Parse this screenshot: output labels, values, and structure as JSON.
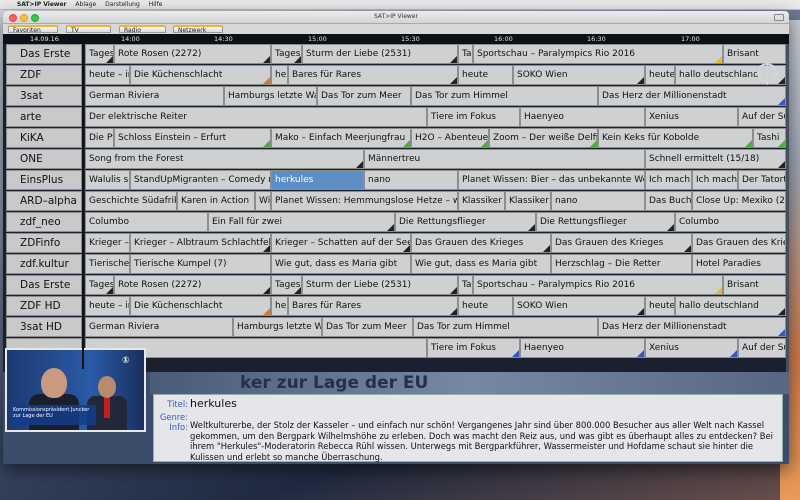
{
  "menubar": {
    "apple": "",
    "app_name": "SAT>IP Viewer",
    "items": [
      "Ablage",
      "Darstellung",
      "Hilfe"
    ]
  },
  "window": {
    "title": "SAT>IP Viewer"
  },
  "tabs": [
    "Favoriten",
    "TV",
    "Radio",
    "Netzwerk"
  ],
  "time_header": {
    "date": "14.09.16",
    "times": [
      "14:00",
      "14:30",
      "15:00",
      "15:30",
      "16:00",
      "16:30",
      "17:00"
    ]
  },
  "channels": [
    {
      "name": "Das Erste",
      "programs": [
        {
          "title": "Tages",
          "mark": "blk"
        },
        {
          "title": "Rote Rosen (2272)",
          "mark": "blk"
        },
        {
          "title": "Tages",
          "mark": "blk"
        },
        {
          "title": "Sturm der Liebe (2531)",
          "mark": "blk"
        },
        {
          "title": "Ta",
          "mark": ""
        },
        {
          "title": "Sportschau – Paralympics Rio 2016",
          "mark": "yel"
        },
        {
          "title": "Brisant",
          "mark": ""
        }
      ]
    },
    {
      "name": "ZDF",
      "programs": [
        {
          "title": "heute – in",
          "mark": ""
        },
        {
          "title": "Die Küchenschlacht",
          "mark": "org"
        },
        {
          "title": "he",
          "mark": ""
        },
        {
          "title": "Bares für Rares",
          "mark": "blk"
        },
        {
          "title": "heute",
          "mark": ""
        },
        {
          "title": "SOKO Wien",
          "mark": "blk"
        },
        {
          "title": "heute",
          "mark": ""
        },
        {
          "title": "hallo deutschland",
          "mark": "blk"
        }
      ]
    },
    {
      "name": "3sat",
      "programs": [
        {
          "title": "German Riviera",
          "mark": ""
        },
        {
          "title": "Hamburgs letzte Wan",
          "mark": ""
        },
        {
          "title": "Das Tor zum Meer",
          "mark": ""
        },
        {
          "title": "Das Tor zum Himmel",
          "mark": ""
        },
        {
          "title": "Das Herz der Millionenstadt",
          "mark": "blu"
        }
      ]
    },
    {
      "name": "arte",
      "programs": [
        {
          "title": "Der elektrische Reiter",
          "mark": ""
        },
        {
          "title": "Tiere im Fokus",
          "mark": ""
        },
        {
          "title": "Haenyeo",
          "mark": ""
        },
        {
          "title": "Xenius",
          "mark": ""
        },
        {
          "title": "Auf der Su",
          "mark": ""
        }
      ]
    },
    {
      "name": "KiKA",
      "programs": [
        {
          "title": "Die Pf",
          "mark": ""
        },
        {
          "title": "Schloss Einstein – Erfurt",
          "mark": "grn"
        },
        {
          "title": "Mako – Einfach Meerjungfrau",
          "mark": "grn"
        },
        {
          "title": "H2O – Abenteuer",
          "mark": "grn"
        },
        {
          "title": "Zoom – Der weiße Delfin",
          "mark": "grn"
        },
        {
          "title": "Kein Keks für Kobolde",
          "mark": "grn"
        },
        {
          "title": "Tashi",
          "mark": "grn"
        }
      ]
    },
    {
      "name": "ONE",
      "programs": [
        {
          "title": "Song from the Forest",
          "mark": "blk"
        },
        {
          "title": "Männertreu",
          "mark": ""
        },
        {
          "title": "Schnell ermittelt (15/18)",
          "mark": "blk"
        }
      ]
    },
    {
      "name": "EinsPlus",
      "programs": [
        {
          "title": "Walulis si",
          "mark": ""
        },
        {
          "title": "StandUpMigranten – Comedy mit",
          "mark": ""
        },
        {
          "title": "herkules",
          "mark": ""
        },
        {
          "title": "nano",
          "mark": ""
        },
        {
          "title": "Planet Wissen: Bier – das unbekannte Wesen",
          "mark": ""
        },
        {
          "title": "Ich mach`",
          "mark": ""
        },
        {
          "title": "Ich mach`",
          "mark": ""
        },
        {
          "title": "Der Tatort",
          "mark": ""
        }
      ]
    },
    {
      "name": "ARD–alpha",
      "programs": [
        {
          "title": "Geschichte Südafrika",
          "mark": ""
        },
        {
          "title": "Karen in Action",
          "mark": ""
        },
        {
          "title": "Wi",
          "mark": ""
        },
        {
          "title": "Planet Wissen: Hemmungslose Hetze – was",
          "mark": ""
        },
        {
          "title": "Klassiker",
          "mark": ""
        },
        {
          "title": "Klassiker",
          "mark": ""
        },
        {
          "title": "nano",
          "mark": ""
        },
        {
          "title": "Das Buch",
          "mark": ""
        },
        {
          "title": "Close Up: Mexiko (2/",
          "mark": ""
        }
      ]
    },
    {
      "name": "zdf_neo",
      "programs": [
        {
          "title": "Columbo",
          "mark": ""
        },
        {
          "title": "Ein Fall für zwei",
          "mark": "blk"
        },
        {
          "title": "Die Rettungsflieger",
          "mark": "blk"
        },
        {
          "title": "Die Rettungsflieger",
          "mark": "blk"
        },
        {
          "title": "Columbo",
          "mark": ""
        }
      ]
    },
    {
      "name": "ZDFinfo",
      "programs": [
        {
          "title": "Krieger –",
          "mark": ""
        },
        {
          "title": "Krieger – Albtraum Schlachtfeld",
          "mark": "blk"
        },
        {
          "title": "Krieger – Schatten auf der Seele",
          "mark": "blk"
        },
        {
          "title": "Das Grauen des Krieges",
          "mark": "blk"
        },
        {
          "title": "Das Grauen des Krieges",
          "mark": "blk"
        },
        {
          "title": "Das Grauen des Krieg",
          "mark": ""
        }
      ]
    },
    {
      "name": "zdf.kultur",
      "programs": [
        {
          "title": "Tierische",
          "mark": ""
        },
        {
          "title": "Tierische Kumpel (7)",
          "mark": ""
        },
        {
          "title": "Wie gut, dass es Maria gibt",
          "mark": ""
        },
        {
          "title": "Wie gut, dass es Maria gibt",
          "mark": ""
        },
        {
          "title": "Herzschlag – Die Retter",
          "mark": ""
        },
        {
          "title": "Hotel Paradies",
          "mark": ""
        }
      ]
    },
    {
      "name": "Das Erste HD",
      "programs": [
        {
          "title": "Tages",
          "mark": "blk"
        },
        {
          "title": "Rote Rosen (2272)",
          "mark": "blk"
        },
        {
          "title": "Tages",
          "mark": "blk"
        },
        {
          "title": "Sturm der Liebe (2531)",
          "mark": "blk"
        },
        {
          "title": "Ta",
          "mark": ""
        },
        {
          "title": "Sportschau – Paralympics Rio 2016",
          "mark": "yel"
        },
        {
          "title": "Brisant",
          "mark": ""
        }
      ]
    },
    {
      "name": "ZDF HD",
      "programs": [
        {
          "title": "heute – in",
          "mark": ""
        },
        {
          "title": "Die Küchenschlacht",
          "mark": "org"
        },
        {
          "title": "he",
          "mark": ""
        },
        {
          "title": "Bares für Rares",
          "mark": "blk"
        },
        {
          "title": "heute",
          "mark": ""
        },
        {
          "title": "SOKO Wien",
          "mark": "blk"
        },
        {
          "title": "heute",
          "mark": ""
        },
        {
          "title": "hallo deutschland",
          "mark": "blk"
        }
      ]
    },
    {
      "name": "3sat HD",
      "programs": [
        {
          "title": "German Riviera",
          "mark": ""
        },
        {
          "title": "Hamburgs letzte Wa",
          "mark": ""
        },
        {
          "title": "Das Tor zum Meer",
          "mark": ""
        },
        {
          "title": "Das Tor zum Himmel",
          "mark": ""
        },
        {
          "title": "Das Herz der Millionenstadt",
          "mark": "blu"
        }
      ]
    },
    {
      "name": "",
      "programs": [
        {
          "title": "",
          "mark": ""
        },
        {
          "title": "Tiere im Fokus",
          "mark": "blu"
        },
        {
          "title": "Haenyeo",
          "mark": "blu"
        },
        {
          "title": "Xenius",
          "mark": "blu"
        },
        {
          "title": "Auf der Su",
          "mark": ""
        }
      ]
    }
  ],
  "video": {
    "caption": "Kommissionspräsident Juncker zur Lage der EU",
    "logo": "①",
    "banner_text": "ker zur Lage der EU"
  },
  "details": {
    "title_label": "Titel:",
    "title_value": "herkules",
    "genre_label": "Genre:",
    "genre_value": "",
    "info_label": "Info:",
    "info_value": "Weltkulturerbe, der Stolz der Kasseler – und einfach nur schön! Vergangenes Jahr sind über 800.000 Besucher aus aller Welt nach Kassel gekommen, um den Bergpark Wilhelmshöhe zu erleben. Doch was macht den Reiz aus, und was gibt es überhaupt alles zu entdecken? Bei ihrem \"Herkules\"-Moderatorin Rebecca Rühl wissen. Unterwegs mit Bergparkführer, Wassermeister und Hofdame schaut sie hinter die Kulissen und erlebt so manche Überraschung."
  },
  "selected_program": "herkules"
}
